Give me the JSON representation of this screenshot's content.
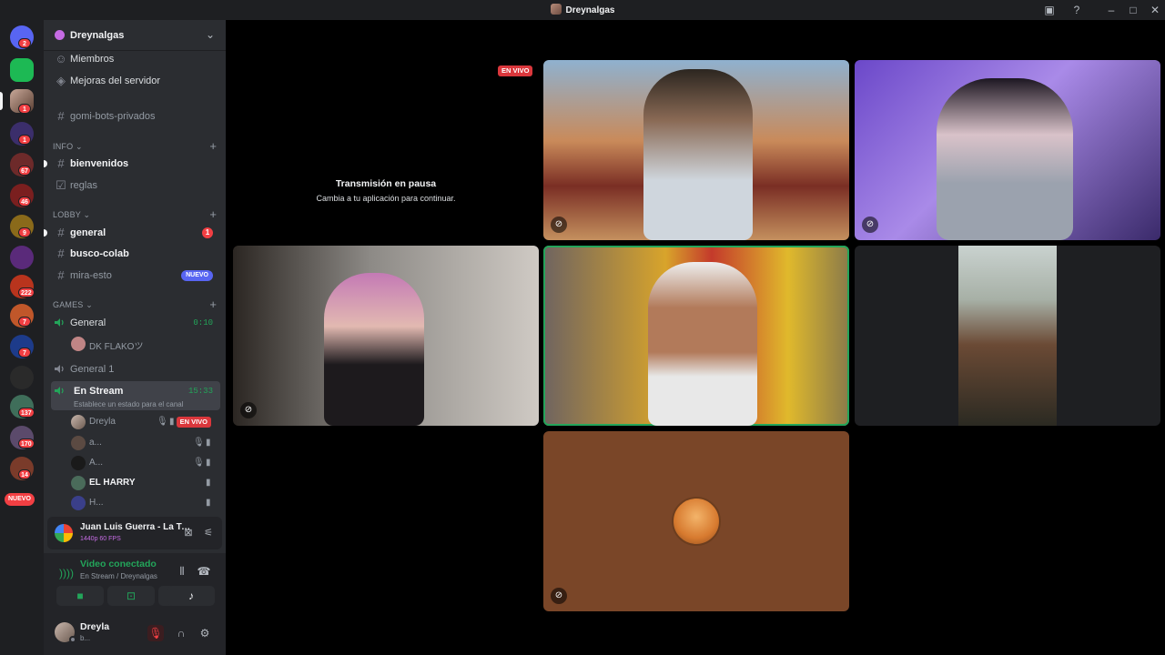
{
  "window": {
    "title": "Dreynalgas"
  },
  "rail": {
    "badges": [
      "2",
      "1",
      "1",
      "67",
      "46",
      "9",
      "222",
      "7",
      "7",
      "137",
      "170",
      "14"
    ],
    "new_label": "NUEVO"
  },
  "server": {
    "name": "Dreynalgas"
  },
  "sidebar": {
    "members": "Miembros",
    "boosts": "Mejoras del servidor",
    "bots_channel": "gomi-bots-privados",
    "cat_info": "INFO",
    "welcome": "bienvenidos",
    "rules": "reglas",
    "cat_lobby": "LOBBY",
    "general_text": "general",
    "general_mentions": "1",
    "busco": "busco-colab",
    "mira": "mira-esto",
    "nuevo": "NUEVO",
    "cat_games": "GAMES",
    "voice_general": "General",
    "voice_general_time": "0:10",
    "voice_general_user": "DK FLAKOツ",
    "voice_general1": "General 1",
    "voice_stream": "En Stream",
    "voice_stream_time": "15:33",
    "voice_stream_status": "Establece un estado para el canal",
    "stream_users": [
      {
        "name": "Dreyla",
        "live": "EN VIVO"
      },
      {
        "name": "a..."
      },
      {
        "name": "A..."
      },
      {
        "name": "EL HARRY"
      },
      {
        "name": "H..."
      }
    ]
  },
  "activity": {
    "title": "Juan Luis Guerra - La Travesía...",
    "quality": "1440p 60 FPS"
  },
  "voice_panel": {
    "title": "Video conectado",
    "channel": "En Stream / Dreynalgas"
  },
  "user": {
    "name": "Dreyla",
    "status": "b..."
  },
  "stage": {
    "paused_title": "Transmisión en pausa",
    "paused_sub": "Cambia a tu aplicación para continuar.",
    "live_label": "EN VIVO"
  },
  "colors": {
    "accent": "#5865f2",
    "live": "#da373c",
    "speaking": "#23a55a",
    "background": "#2b2d31"
  },
  "icons": [
    "discord-icon",
    "hash-icon",
    "speaker-icon",
    "mic-muted-icon",
    "camera-icon",
    "headphones-icon",
    "gear-icon",
    "hangup-icon",
    "soundboard-icon",
    "activities-icon",
    "screen-share-icon",
    "signal-icon",
    "minimize-icon",
    "maximize-icon",
    "close-icon",
    "help-icon",
    "inbox-icon"
  ]
}
